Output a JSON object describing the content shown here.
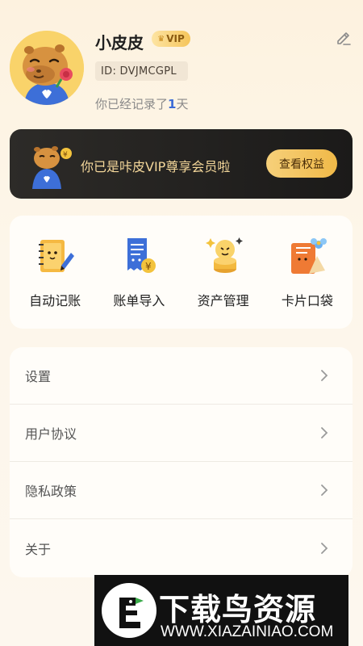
{
  "profile": {
    "name": "小皮皮",
    "vip_badge": "VIP",
    "id": "ID: DVJMCGPL",
    "record_prefix": "你已经记录了",
    "record_days": "1",
    "record_suffix": "天"
  },
  "vip_banner": {
    "text": "你已是咔皮VIP尊享会员啦",
    "button": "查看权益"
  },
  "tools": [
    {
      "label": "自动记账",
      "icon": "notebook-pen-icon"
    },
    {
      "label": "账单导入",
      "icon": "bill-import-icon"
    },
    {
      "label": "资产管理",
      "icon": "coins-icon"
    },
    {
      "label": "卡片口袋",
      "icon": "card-pocket-icon"
    }
  ],
  "menu": [
    {
      "label": "设置"
    },
    {
      "label": "用户协议"
    },
    {
      "label": "隐私政策"
    },
    {
      "label": "关于"
    }
  ],
  "watermark": {
    "title": "下载鸟资源",
    "url": "WWW.XIAZAINIAO.COM"
  },
  "colors": {
    "accent": "#3b6bd6",
    "vip_gold": "#f4d79a",
    "banner_bg": "#1e1d1b",
    "avatar_bg": "#f9d36a"
  }
}
